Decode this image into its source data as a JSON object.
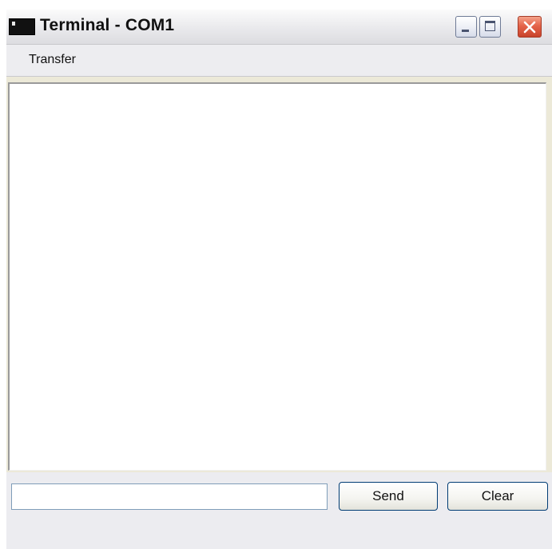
{
  "window": {
    "title": "Terminal - COM1",
    "icon": "terminal-icon",
    "controls": {
      "minimize": "minimize-icon",
      "maximize": "maximize-icon",
      "close": "close-icon"
    }
  },
  "menubar": {
    "items": [
      {
        "label": "Transfer"
      }
    ]
  },
  "terminal": {
    "output": ""
  },
  "input_bar": {
    "command_value": "",
    "send_label": "Send",
    "clear_label": "Clear"
  },
  "colors": {
    "close_button": "#e5644a",
    "button_border": "#003c74",
    "input_border": "#7f9db9"
  }
}
